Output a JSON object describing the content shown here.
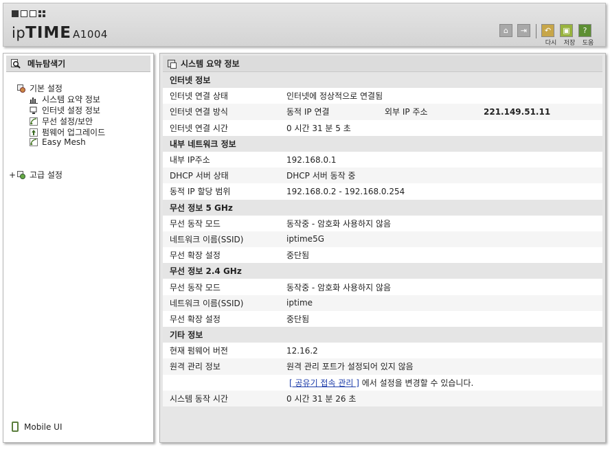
{
  "header": {
    "logo_brand_a": "ip",
    "logo_brand_b": "TIME",
    "logo_model": "A1004",
    "buttons": [
      {
        "name": "home-button",
        "label": ""
      },
      {
        "name": "logout-button",
        "label": ""
      },
      {
        "name": "undo-button",
        "label": "다시"
      },
      {
        "name": "save-button",
        "label": "저장"
      },
      {
        "name": "help-button",
        "label": "도움"
      }
    ]
  },
  "sidebar": {
    "title": "메뉴탐색기",
    "groups": [
      {
        "label": "기본 설정",
        "items": [
          {
            "label": "시스템 요약 정보"
          },
          {
            "label": "인터넷 설정 정보"
          },
          {
            "label": "무선 설정/보안"
          },
          {
            "label": "펌웨어 업그레이드"
          },
          {
            "label": "Easy Mesh"
          }
        ]
      },
      {
        "label": "고급 설정",
        "expander": "+"
      }
    ],
    "mobile_label": "Mobile UI"
  },
  "main": {
    "title": "시스템 요약 정보",
    "sections": {
      "internet": {
        "title": "인터넷 정보",
        "conn_state_label": "인터넷 연결 상태",
        "conn_state": "인터넷에 정상적으로 연결됨",
        "conn_method_label": "인터넷 연결 방식",
        "conn_method": "동적 IP 연결",
        "external_ip_label": "외부 IP 주소",
        "external_ip": "221.149.51.11",
        "conn_time_label": "인터넷 연결 시간",
        "conn_time": "0 시간 31 분 5 초"
      },
      "lan": {
        "title": "내부 네트워크 정보",
        "ip_label": "내부 IP주소",
        "ip": "192.168.0.1",
        "dhcp_label": "DHCP 서버 상태",
        "dhcp": "DHCP 서버 동작 중",
        "range_label": "동적 IP 할당 범위",
        "range": "192.168.0.2 -  192.168.0.254"
      },
      "wifi5": {
        "title": "무선 정보 5 GHz",
        "mode_label": "무선 동작 모드",
        "mode": "동작중 - 암호화 사용하지 않음",
        "ssid_label": "네트워크 이름(SSID)",
        "ssid": "iptime5G",
        "ext_label": "무선 확장 설정",
        "ext": "중단됨"
      },
      "wifi24": {
        "title": "무선 정보 2.4 GHz",
        "mode_label": "무선 동작 모드",
        "mode": "동작중 - 암호화 사용하지 않음",
        "ssid_label": "네트워크 이름(SSID)",
        "ssid": "iptime",
        "ext_label": "무선 확장 설정",
        "ext": "중단됨"
      },
      "etc": {
        "title": "기타 정보",
        "fw_label": "현재 펌웨어 버전",
        "fw": "12.16.2",
        "remote_label": "원격 관리 정보",
        "remote": "원격 관리 포트가 설정되어 있지 않음",
        "remote_link": "[ 공유기 접속 관리 ]",
        "remote_link_suffix": " 에서 설정을 변경할 수 있습니다.",
        "uptime_label": "시스템 동작 시간",
        "uptime": "0 시간 31 분 26 초"
      }
    }
  },
  "colors": {
    "accent_olive": "#8fa832",
    "accent_gold": "#c9a53a",
    "grey_btn": "#9a9a9a"
  }
}
